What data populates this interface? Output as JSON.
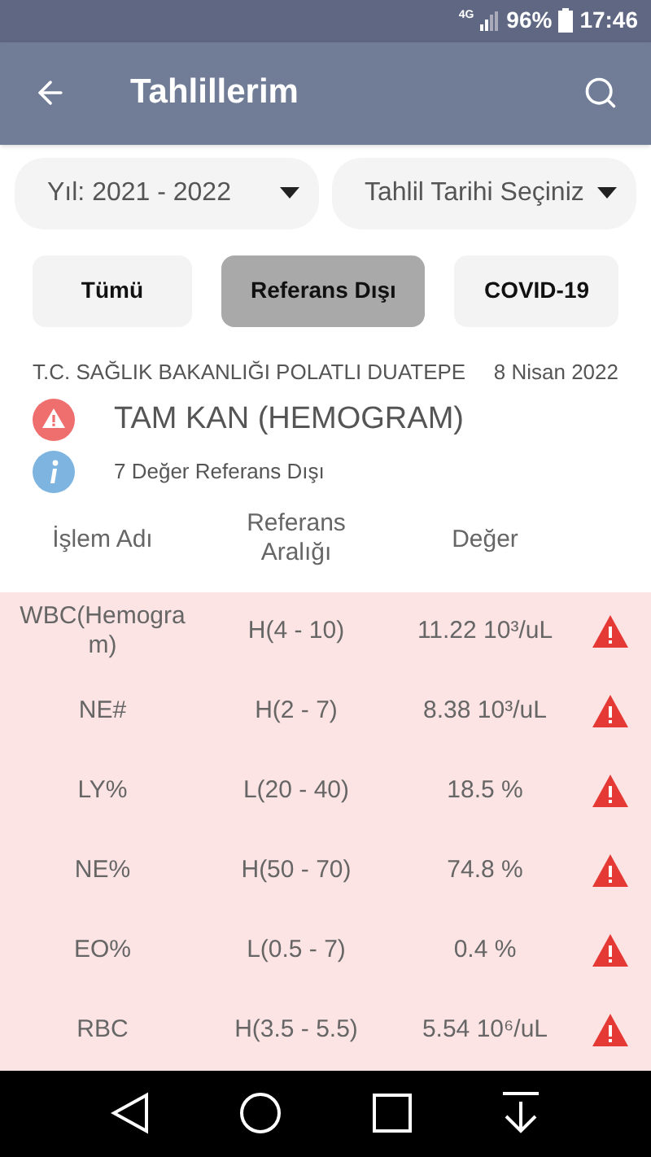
{
  "status_bar": {
    "network": "4G",
    "battery": "96%",
    "time": "17:46"
  },
  "app_bar": {
    "title": "Tahlillerim"
  },
  "dropdowns": [
    {
      "value": "Yıl: 2021 - 2022"
    },
    {
      "value": "Tahlil Tarihi Seçiniz"
    }
  ],
  "filters": [
    {
      "label": "Tümü",
      "selected": false
    },
    {
      "label": "Referans Dışı",
      "selected": true
    },
    {
      "label": "COVID-19",
      "selected": false
    }
  ],
  "result": {
    "institution": "T.C. SAĞLIK BAKANLIĞI POLATLI DUATEPE",
    "date": "8 Nisan 2022",
    "test_name": "TAM KAN (HEMOGRAM)",
    "summary": "7 Değer Referans Dışı"
  },
  "table": {
    "columns": [
      "İşlem Adı",
      "Referans Aralığı",
      "Değer"
    ],
    "rows": [
      {
        "name": "WBC(Hemogram)",
        "range": "H(4 - 10)",
        "value": "11.22 10³/uL",
        "out_of_range": true
      },
      {
        "name": "NE#",
        "range": "H(2 - 7)",
        "value": "8.38 10³/uL",
        "out_of_range": true
      },
      {
        "name": "LY%",
        "range": "L(20 - 40)",
        "value": "18.5 %",
        "out_of_range": true
      },
      {
        "name": "NE%",
        "range": "H(50 - 70)",
        "value": "74.8 %",
        "out_of_range": true
      },
      {
        "name": "EO%",
        "range": "L(0.5 - 7)",
        "value": "0.4 %",
        "out_of_range": true
      },
      {
        "name": "RBC",
        "range": "H(3.5 - 5.5)",
        "value": "5.54 10⁶/uL",
        "out_of_range": true
      }
    ]
  }
}
